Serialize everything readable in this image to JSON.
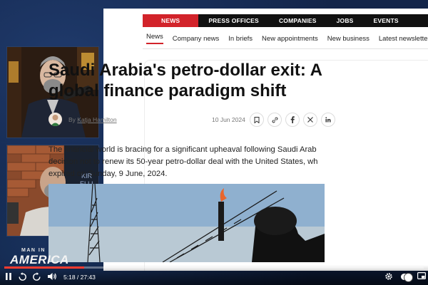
{
  "article": {
    "nav": [
      {
        "label": "NEWS",
        "active": true
      },
      {
        "label": "PRESS OFFICES",
        "active": false
      },
      {
        "label": "COMPANIES",
        "active": false
      },
      {
        "label": "JOBS",
        "active": false
      },
      {
        "label": "EVENTS",
        "active": false
      }
    ],
    "subnav": [
      {
        "label": "News",
        "active": true
      },
      {
        "label": "Company news",
        "active": false
      },
      {
        "label": "In briefs",
        "active": false
      },
      {
        "label": "New appointments",
        "active": false
      },
      {
        "label": "New business",
        "active": false
      },
      {
        "label": "Latest newsletter",
        "active": false
      }
    ],
    "headline_line1": "Saudi Arabia's petro-dollar exit: A",
    "headline_line2": "global finance paradigm shift",
    "by_prefix": "By",
    "author": "Katja Hamilton",
    "date": "10 Jun 2024",
    "share_icons": [
      "bookmark-icon",
      "link-icon",
      "facebook-icon",
      "x-icon",
      "linkedin-icon"
    ],
    "body_line1": "The financial world is bracing for a significant upheaval following Saudi Arab",
    "body_line2": "decision not to renew its 50-year petro-dollar deal with the United States, wh",
    "body_line3": "expired on Sunday, 9 June, 2024."
  },
  "show": {
    "logo_top": "MAN IN",
    "logo_main": "AMERICA"
  },
  "player": {
    "current_time": "5:18",
    "duration": "27:43",
    "time_display": "5:18 / 27:43",
    "progress_fraction": 0.191
  },
  "colors": {
    "accent_red": "#d2232a",
    "nav_black": "#111111",
    "progress_red": "#ff3b30"
  }
}
